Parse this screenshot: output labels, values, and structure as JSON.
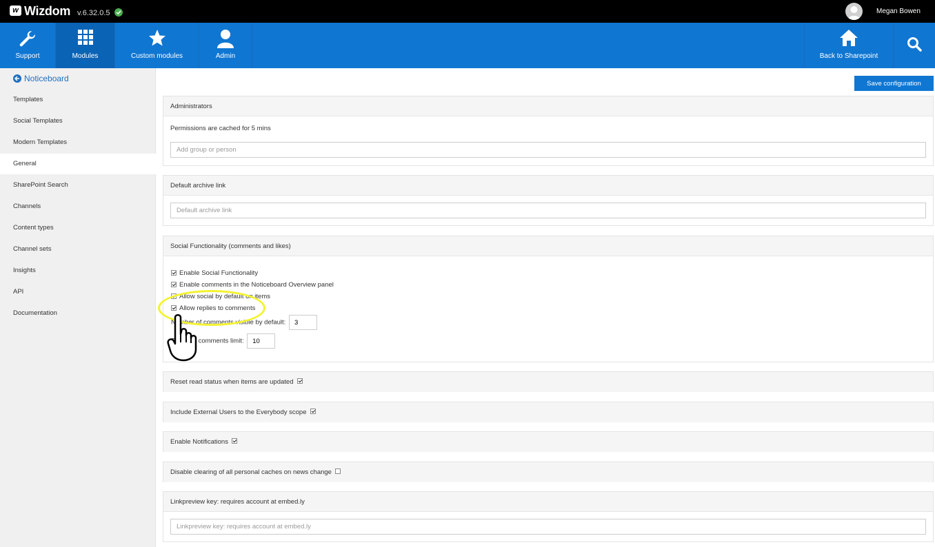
{
  "app": {
    "brand": "Wizdom",
    "version": "v.6.32.0.5",
    "user_name": "Megan Bowen",
    "accent_color": "#0f76d2",
    "status_color": "#4caf50"
  },
  "nav": {
    "support": "Support",
    "modules": "Modules",
    "custom_modules": "Custom modules",
    "admin": "Admin",
    "back_to_sharepoint": "Back to Sharepoint",
    "icons": {
      "support": "wrench-icon",
      "modules": "grid-icon",
      "custom_modules": "star-icon",
      "admin": "user-icon",
      "back_to_sharepoint": "home-icon",
      "search": "search-icon"
    }
  },
  "sidebar": {
    "title": "Noticeboard",
    "items": [
      {
        "label": "Templates"
      },
      {
        "label": "Social Templates"
      },
      {
        "label": "Modern Templates"
      },
      {
        "label": "General",
        "active": true
      },
      {
        "label": "SharePoint Search"
      },
      {
        "label": "Channels"
      },
      {
        "label": "Content types"
      },
      {
        "label": "Channel sets"
      },
      {
        "label": "Insights"
      },
      {
        "label": "API"
      },
      {
        "label": "Documentation"
      }
    ]
  },
  "main": {
    "save_label": "Save configuration",
    "administrators": {
      "title": "Administrators",
      "note": "Permissions are cached for 5 mins",
      "placeholder": "Add group or person"
    },
    "archive": {
      "title": "Default archive link",
      "placeholder": "Default archive link"
    },
    "social": {
      "title": "Social Functionality (comments and likes)",
      "options": [
        {
          "label": "Enable Social Functionality",
          "checked": true
        },
        {
          "label": "Enable comments in the Noticeboard Overview panel",
          "checked": true
        },
        {
          "label": "Allow social by default on items",
          "checked": true
        },
        {
          "label": "Allow replies to comments",
          "checked": true
        }
      ],
      "comments_visible_label": "Number of comments visible by default:",
      "comments_visible_value": "3",
      "previous_limit_label": "Previous comments limit:",
      "previous_limit_value": "10"
    },
    "reset_read": {
      "title": "Reset read status when items are updated",
      "checked": true
    },
    "external_users": {
      "title": "Include External Users to the Everybody scope",
      "checked": true
    },
    "notifications": {
      "title": "Enable Notifications",
      "checked": true
    },
    "disable_cache": {
      "title": "Disable clearing of all personal caches on news change",
      "checked": false
    },
    "linkpreview": {
      "title": "Linkpreview key: requires account at embed.ly",
      "placeholder": "Linkpreview key: requires account at embed.ly"
    }
  }
}
